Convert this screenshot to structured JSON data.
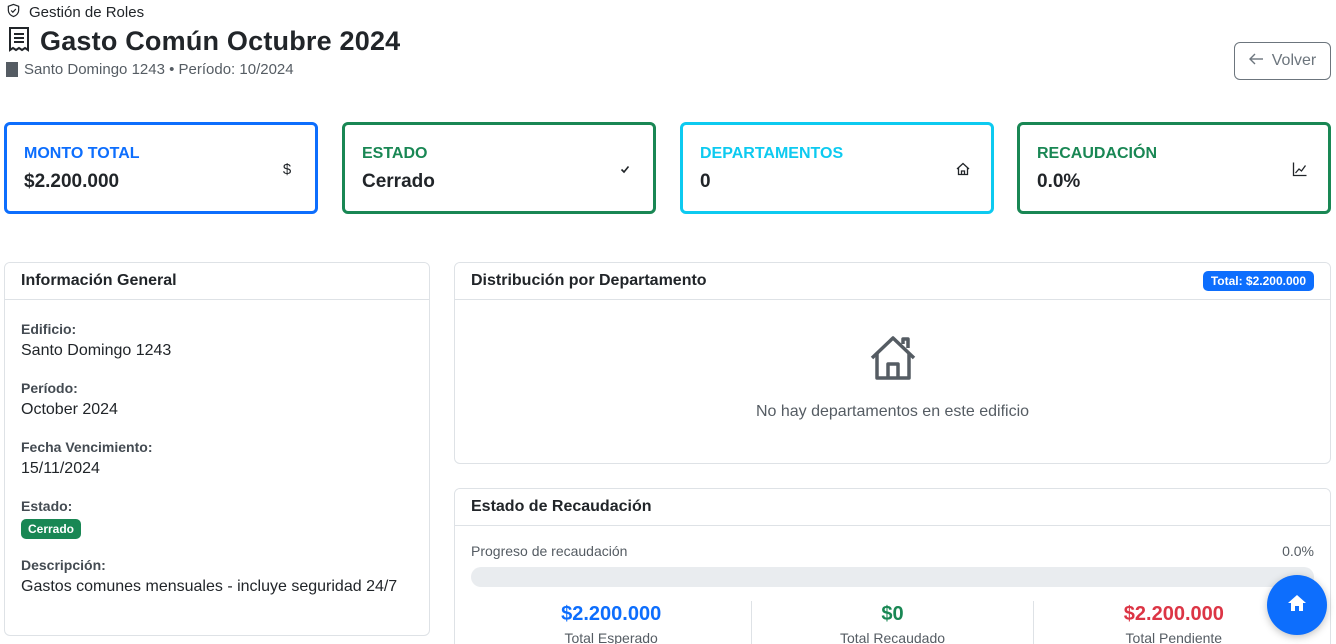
{
  "breadcrumb": {
    "label": "Gestión de Roles",
    "icon": "shield-icon"
  },
  "header": {
    "title": "Gasto Común Octubre 2024",
    "title_icon": "receipt-icon",
    "subtitle": "Santo Domingo 1243 • Período: 10/2024",
    "subtitle_icon": "building-icon",
    "back_label": "Volver"
  },
  "stats": [
    {
      "label": "Monto Total",
      "value": "$2.200.000",
      "icon": "dollar-icon",
      "color": "#0d6efd",
      "label_color": "#0d6efd"
    },
    {
      "label": "Estado",
      "value": "Cerrado",
      "icon": "check-icon",
      "color": "#198754",
      "label_color": "#198754"
    },
    {
      "label": "Departamentos",
      "value": "0",
      "icon": "house-icon",
      "color": "#0dcaf0",
      "label_color": "#0dcaf0"
    },
    {
      "label": "Recaudación",
      "value": "0.0%",
      "icon": "chart-line-icon",
      "color": "#198754",
      "label_color": "#198754"
    }
  ],
  "info": {
    "title": "Información General",
    "edificio_label": "Edificio:",
    "edificio": "Santo Domingo 1243",
    "periodo_label": "Período:",
    "periodo": "October 2024",
    "vencimiento_label": "Fecha Vencimiento:",
    "vencimiento": "15/11/2024",
    "estado_label": "Estado:",
    "estado": "Cerrado",
    "descripcion_label": "Descripción:",
    "descripcion": "Gastos comunes mensuales - incluye seguridad 24/7"
  },
  "distribucion": {
    "title": "Distribución por Departamento",
    "total_badge": "Total: $2.200.000",
    "empty_icon": "house-icon",
    "empty_text": "No hay departamentos en este edificio"
  },
  "recaudacion": {
    "title": "Estado de Recaudación",
    "progress_label": "Progreso de recaudación",
    "progress_text": "0.0%",
    "progress_fraction": 0.0,
    "esperado": "$2.200.000",
    "esperado_label": "Total Esperado",
    "recaudado": "$0",
    "recaudado_label": "Total Recaudado",
    "pendiente": "$2.200.000",
    "pendiente_label": "Total Pendiente"
  },
  "fab_icon": "house-icon",
  "colors": {
    "primary": "#0d6efd",
    "success": "#198754",
    "info": "#0dcaf0",
    "danger": "#dc3545"
  }
}
